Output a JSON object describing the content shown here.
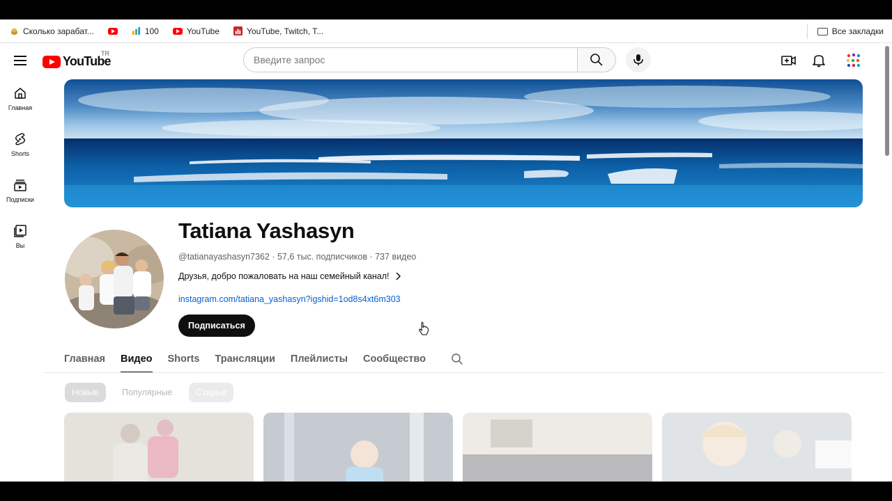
{
  "bookmarks": {
    "items": [
      {
        "label": "Сколько зарабат...",
        "icon": "coins-icon"
      },
      {
        "label": "",
        "icon": "youtube-icon"
      },
      {
        "label": "100",
        "icon": "bar-chart-icon"
      },
      {
        "label": "YouTube",
        "icon": "youtube-icon"
      },
      {
        "label": "YouTube, Twitch, T...",
        "icon": "stats-icon"
      }
    ],
    "all_bookmarks": "Все закладки"
  },
  "header": {
    "logo_text": "YouTube",
    "region": "TR",
    "search_placeholder": "Введите запрос"
  },
  "sidebar": {
    "items": [
      {
        "label": "Главная",
        "icon": "home-icon"
      },
      {
        "label": "Shorts",
        "icon": "shorts-icon"
      },
      {
        "label": "Подписки",
        "icon": "subscriptions-icon"
      },
      {
        "label": "Вы",
        "icon": "library-icon"
      }
    ]
  },
  "channel": {
    "name": "Tatiana Yashasyn",
    "handle": "@tatianayashasyn7362",
    "subscribers": "57,6 тыс. подписчиков",
    "videos": "737 видео",
    "description": "Друзья, добро пожаловать на наш семейный канал!",
    "link": "instagram.com/tatiana_yashasyn?igshid=1od8s4xt6m303",
    "subscribe_label": "Подписаться"
  },
  "tabs": [
    {
      "label": "Главная",
      "active": false
    },
    {
      "label": "Видео",
      "active": true
    },
    {
      "label": "Shorts",
      "active": false
    },
    {
      "label": "Трансляции",
      "active": false
    },
    {
      "label": "Плейлисты",
      "active": false
    },
    {
      "label": "Сообщество",
      "active": false
    }
  ],
  "filters": [
    "Новые",
    "Популярные",
    "Старые"
  ],
  "colors": {
    "brand_red": "#ff0000",
    "link_blue": "#065fd4",
    "text_primary": "#0f0f0f",
    "text_secondary": "#606060"
  }
}
